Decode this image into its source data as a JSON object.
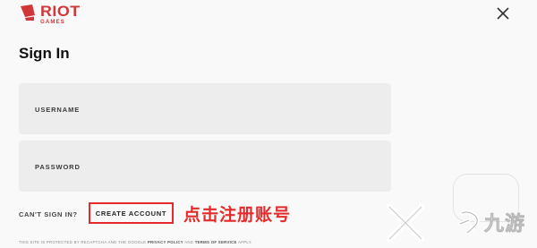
{
  "logo": {
    "main": "RIOT",
    "sub": "GAMES"
  },
  "page": {
    "title": "Sign In"
  },
  "fields": {
    "username": {
      "label": "USERNAME"
    },
    "password": {
      "label": "PASSWORD"
    }
  },
  "links": {
    "cant_sign_in": "CAN'T SIGN IN?",
    "create_account": "CREATE ACCOUNT"
  },
  "annotation": {
    "text": "点击注册账号"
  },
  "legal": {
    "prefix": "THIS SITE IS PROTECTED BY RECAPTCHA AND THE GOOGLE",
    "privacy": "PRIVACY POLICY",
    "and": "AND",
    "terms": "TERMS OF SERVICE",
    "suffix": "APPLY."
  },
  "watermark": {
    "text": "九游"
  },
  "icons": {
    "logo": "fist-icon",
    "close": "close-icon",
    "watermark_x": "x-watermark-icon",
    "watermark_logo": "jiuyou-logo-icon"
  },
  "colors": {
    "brand": "#d13639",
    "annotation": "#e42a2a",
    "field_bg": "#ededed",
    "background": "#f9f9f9"
  }
}
